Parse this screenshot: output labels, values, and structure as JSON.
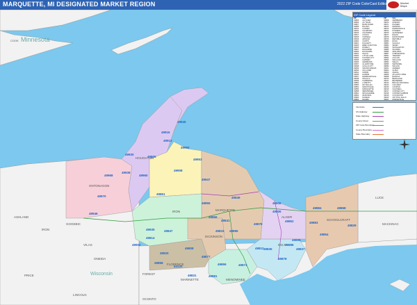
{
  "title": "MARQUETTE, MI DESIGNATED MARKET REGION",
  "edition": "2022 ZIP Code ColorCast Edition",
  "logo_text": [
    "Market",
    "Maps"
  ],
  "regions": {
    "minnesota": "Minnesota",
    "cook": "COOK",
    "ontonagon": "ONTONAGON",
    "houghton": "HOUGHTON",
    "gogebic": "GOGEBIC",
    "iron": "IRON",
    "marquette": "MARQUETTE",
    "alger": "ALGER",
    "schoolcraft": "SCHOOLCRAFT",
    "luce": "LUCE",
    "mackinac": "MACKINAC",
    "delta": "DELTA",
    "dickinson": "DICKINSON",
    "menominee": "MENOMINEE",
    "marinette": "MARINETTE",
    "forest": "FOREST",
    "florence": "FLORENCE",
    "wisconsin": "Wisconsin",
    "vilas": "VILAS",
    "oneida": "ONEIDA",
    "price": "PRICE",
    "lincoln": "LINCOLN",
    "oconto": "OCONTO",
    "ashland": "ASHLAND",
    "iron_wi": "IRON"
  },
  "zip_labels": [
    "49945",
    "49916",
    "49905",
    "49930",
    "49913",
    "49950",
    "49953",
    "49947",
    "49960",
    "49938",
    "49968",
    "49970",
    "49946",
    "49908",
    "49861",
    "49814",
    "49808",
    "49855",
    "49849",
    "49841",
    "49866",
    "49878",
    "49806",
    "49862",
    "49884",
    "49895",
    "49883",
    "49868",
    "49854",
    "49829",
    "49835",
    "49812",
    "49878",
    "49886",
    "49837",
    "49873",
    "49859",
    "49877",
    "49858",
    "49847",
    "49896",
    "54120",
    "49831",
    "49881",
    "49815",
    "49920",
    "49935",
    "49902",
    "49806"
  ],
  "legend": {
    "header": "ZIP Code Legend",
    "columns": [
      "ZIP",
      "City",
      "ZIP",
      "City"
    ],
    "rows": [
      [
        "49805",
        "ALLOUEZ",
        "49868",
        "NEWBERRY"
      ],
      [
        "49806",
        "AU TRAIN",
        "49870",
        "NORWAY"
      ],
      [
        "49807",
        "BARK RIVER",
        "49871",
        "PALMER"
      ],
      [
        "49808",
        "BIG BAY",
        "49872",
        "PERKINS"
      ],
      [
        "49812",
        "CARNEY",
        "49873",
        "PERRONVILLE"
      ],
      [
        "49814",
        "CHAMPION",
        "49874",
        "POWERS"
      ],
      [
        "49815",
        "CHANNING",
        "49876",
        "QUINNESEC"
      ],
      [
        "49817",
        "COOKS",
        "49877",
        "RALPH"
      ],
      [
        "49818",
        "CORNELL",
        "49878",
        "RAPID RIVER"
      ],
      [
        "49819",
        "ARNOLD",
        "49879",
        "REPUBLIC"
      ],
      [
        "49820",
        "CURTIS",
        "49880",
        "ROCK"
      ],
      [
        "49821",
        "DAGGETT",
        "49881",
        "SAGOLA"
      ],
      [
        "49825",
        "EBEN JUNCTION",
        "49883",
        "SENEY"
      ],
      [
        "49826",
        "RUMELY",
        "49884",
        "SHINGLETON"
      ],
      [
        "49827",
        "ENGADINE",
        "49885",
        "SKANDIA"
      ],
      [
        "49829",
        "ESCANABA",
        "49886",
        "SPALDING"
      ],
      [
        "49831",
        "FELCH",
        "49887",
        "STEPHENSON"
      ],
      [
        "49833",
        "LITTLE LAKE",
        "49891",
        "TRENARY"
      ],
      [
        "49834",
        "FOSTER CITY",
        "49892",
        "VULCAN"
      ],
      [
        "49835",
        "GARDEN",
        "49893",
        "WALLACE"
      ],
      [
        "49836",
        "GERMFASK",
        "49894",
        "WELLS"
      ],
      [
        "49837",
        "GLADSTONE",
        "49895",
        "WETMORE"
      ],
      [
        "49838",
        "GOULD CITY",
        "49896",
        "WILSON"
      ],
      [
        "49839",
        "GRAND MARAIS",
        "49901",
        "AHMEEK"
      ],
      [
        "49840",
        "GULLIVER",
        "49902",
        "ALPHA"
      ],
      [
        "49841",
        "GWINN",
        "49903",
        "AMASA"
      ],
      [
        "49845",
        "HARRIS",
        "49905",
        "ATLANTIC MINE"
      ],
      [
        "49847",
        "HERMANSVILLE",
        "49908",
        "BARAGA"
      ],
      [
        "49848",
        "INGALLS",
        "49910",
        "BERGLAND"
      ],
      [
        "49849",
        "ISHPEMING",
        "49911",
        "BESSEMER"
      ],
      [
        "49852",
        "LORETTO",
        "49912",
        "BRUCE CROSSING"
      ],
      [
        "49853",
        "MC MILLAN",
        "49913",
        "CALUMET"
      ],
      [
        "49854",
        "MANISTIQUE",
        "49915",
        "CASPIAN"
      ],
      [
        "49855",
        "MARQUETTE",
        "49916",
        "CHASSELL"
      ],
      [
        "49858",
        "MENOMINEE",
        "49917",
        "COPPER CITY"
      ],
      [
        "49861",
        "MICHIGAMME",
        "49918",
        "COPPER HARBOR"
      ],
      [
        "49862",
        "MUNISING",
        "49919",
        "COVINGTON"
      ],
      [
        "49863",
        "NADEAU",
        "49920",
        "CRYSTAL FALLS"
      ],
      [
        "49864",
        "NAHMA",
        "49921",
        "DODGEVILLE"
      ],
      [
        "49865",
        "NATIONAL MINE",
        "49922",
        "DOLLAR BAY"
      ],
      [
        "49866",
        "NEGAUNEE",
        "49925",
        "EWEN"
      ]
    ]
  },
  "key": {
    "items": [
      "Interstate",
      "US Highway",
      "State Highway",
      "County Road",
      "ZIP Code Boundary",
      "County Boundary",
      "State Boundary"
    ],
    "colors": [
      "#2b6fd6",
      "#2f9d3f",
      "#a23db4",
      "#888888",
      "#44aa55",
      "#cc66cc",
      "#e07030"
    ]
  },
  "colors": {
    "water": "#7cc8ee",
    "land": "#f2f2f2",
    "ontonagon": "#f7cfd9",
    "houghton": "#dcc9f2",
    "baraga": "#fbf3b8",
    "marquette": "#e4cbb0",
    "iron": "#cdf2da",
    "dickinson": "#cbbfa6",
    "menominee": "#c8f0e0",
    "delta": "#c3e8f4",
    "alger": "#e3d2f2",
    "schoolcraft": "#e7c9b0",
    "label_zip": "#1d63c5"
  }
}
